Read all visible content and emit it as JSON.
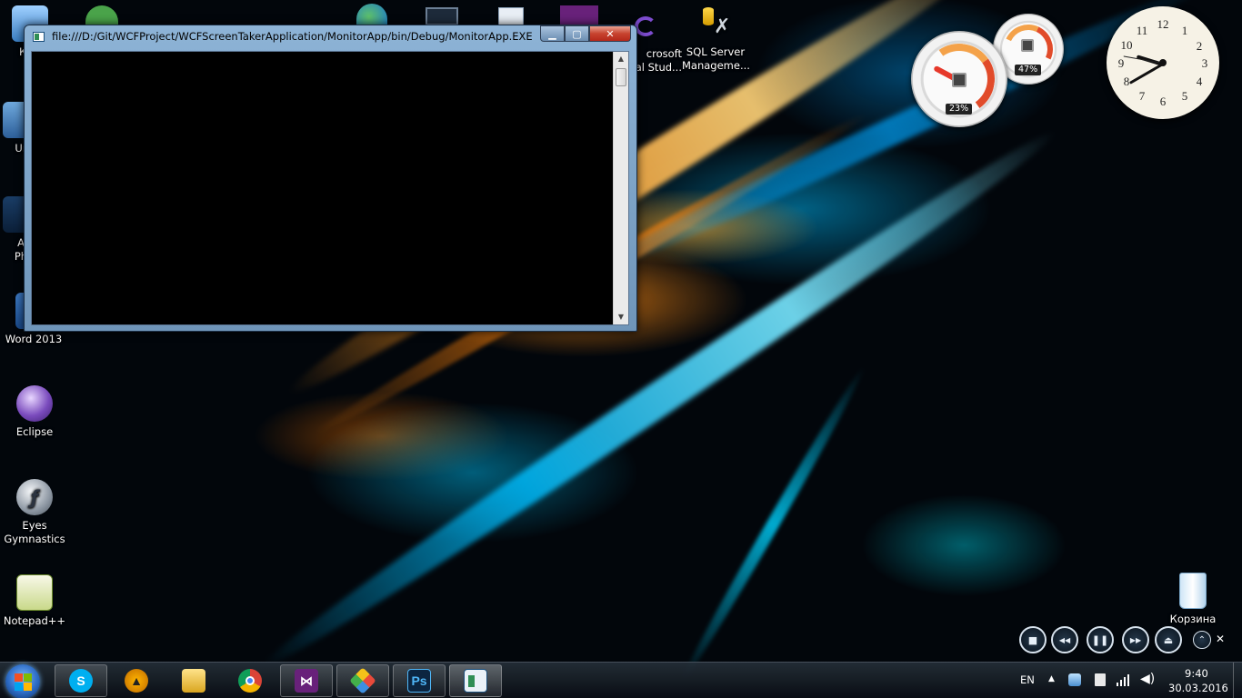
{
  "window": {
    "title": "file:///D:/Git/WCFProject/WCFScreenTakerApplication/MonitorApp/bin/Debug/MonitorApp.EXE",
    "min_glyph": "▁",
    "max_glyph": "▢",
    "close_glyph": "✕"
  },
  "desktop": {
    "icons_left": [
      {
        "label": "Ком"
      },
      {
        "label": "Ur"
      },
      {
        "label": "A\nPh"
      },
      {
        "label": "Word 2013"
      },
      {
        "label": "Eclipse"
      },
      {
        "label": "Eyes\nGymnastics"
      },
      {
        "label": "Notepad++"
      }
    ],
    "icons_top": [
      {
        "label": "crosoft\nal Stud..."
      },
      {
        "label": "SQL Server\nManageme..."
      }
    ],
    "recycle_bin": {
      "label": "Корзина"
    }
  },
  "gadgets": {
    "cpu_percent": "23%",
    "memory_percent": "47%",
    "clock_numbers": [
      "12",
      "1",
      "2",
      "3",
      "4",
      "5",
      "6",
      "7",
      "8",
      "9",
      "10",
      "11"
    ]
  },
  "media_controls": {
    "stop": "■",
    "prev": "◀◀",
    "pause": "❚❚",
    "next": "▶▶",
    "eject": "⏏",
    "up": "⌃",
    "close": "✕"
  },
  "taskbar": {
    "language": "EN",
    "time": "9:40",
    "date": "30.03.2016",
    "apps": [
      "skype-icon",
      "aimp-icon",
      "explorer-icon",
      "chrome-icon",
      "visual-studio-icon",
      "git-extensions-icon",
      "photoshop-icon",
      "monitor-app-icon"
    ],
    "photoshop_label": "Ps"
  },
  "colors": {
    "accent_orange": "#ff8c14",
    "accent_cyan": "#00aae6",
    "close_red": "#c7432f"
  }
}
